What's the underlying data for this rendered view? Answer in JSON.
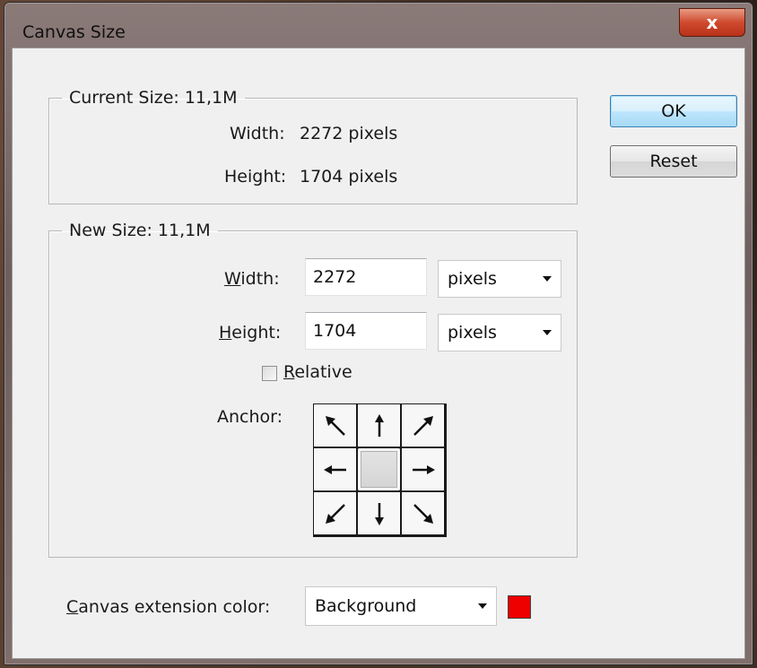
{
  "window": {
    "title": "Canvas Size",
    "close_glyph": "x"
  },
  "current_size": {
    "legend": "Current Size: 11,1M",
    "width_label": "Width:",
    "width_value": "2272 pixels",
    "height_label": "Height:",
    "height_value": "1704 pixels"
  },
  "new_size": {
    "legend": "New Size: 11,1M",
    "width_label_mnemonic": "W",
    "width_label_rest": "idth:",
    "width_value": "2272",
    "width_unit": "pixels",
    "height_label_mnemonic": "H",
    "height_label_rest": "eight:",
    "height_value": "1704",
    "height_unit": "pixels",
    "relative_mnemonic": "R",
    "relative_rest": "elative",
    "relative_checked": false,
    "anchor_label": "Anchor:",
    "anchor_icons": [
      "arrow-up-left-icon",
      "arrow-up-icon",
      "arrow-up-right-icon",
      "arrow-left-icon",
      "anchor-center",
      "arrow-right-icon",
      "arrow-down-left-icon",
      "arrow-down-icon",
      "arrow-down-right-icon"
    ]
  },
  "buttons": {
    "ok": "OK",
    "reset": "Reset"
  },
  "extension": {
    "label_mnemonic": "C",
    "label_rest": "anvas extension color:",
    "value": "Background",
    "swatch_color": "#ee0000"
  }
}
